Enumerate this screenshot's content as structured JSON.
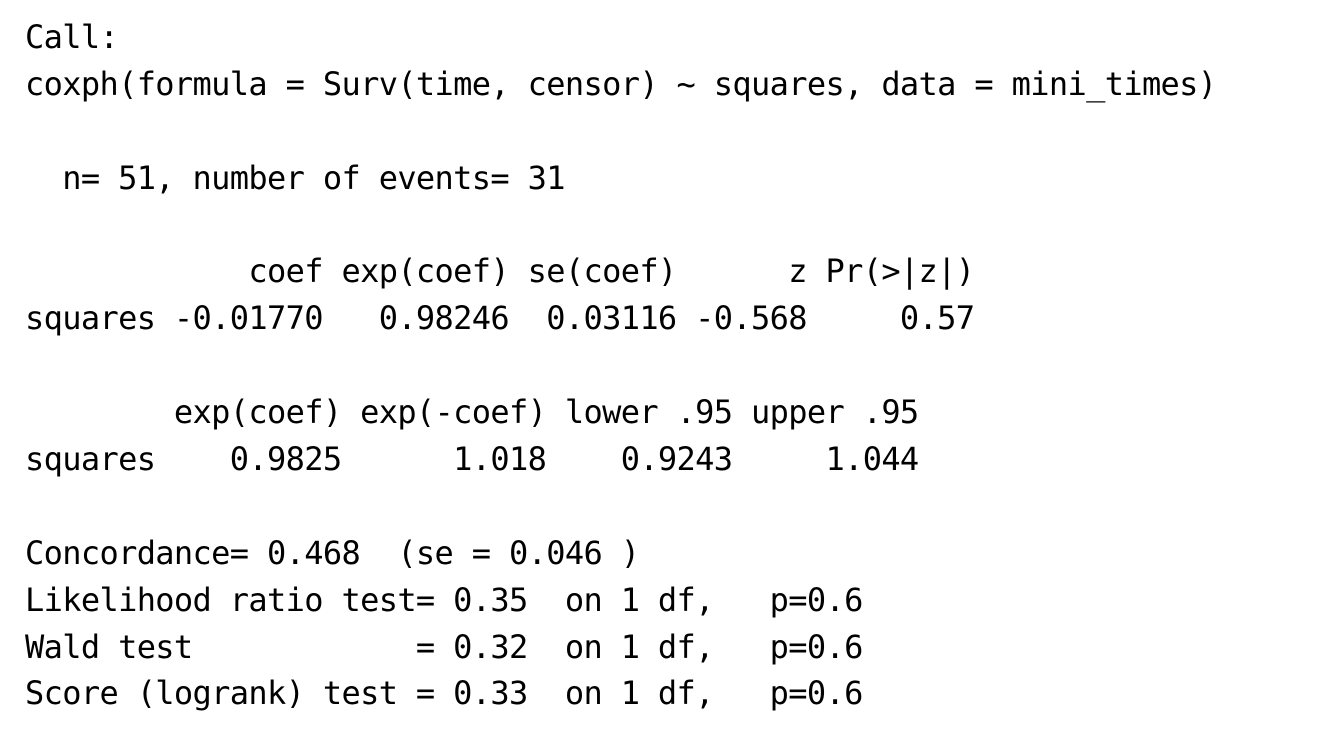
{
  "console": {
    "call_header": "Call:",
    "call_formula": "coxph(formula = Surv(time, censor) ~ squares, data = mini_times)",
    "summary_counts": "  n= 51, number of events= 31",
    "coef_table": {
      "header": "            coef exp(coef) se(coef)      z Pr(>|z|)",
      "rows": [
        "squares -0.01770   0.98246  0.03116 -0.568     0.57"
      ]
    },
    "ci_table": {
      "header": "        exp(coef) exp(-coef) lower .95 upper .95",
      "rows": [
        "squares    0.9825      1.018    0.9243     1.044"
      ]
    },
    "tests": {
      "concordance": "Concordance= 0.468  (se = 0.046 )",
      "likelihood_ratio": "Likelihood ratio test= 0.35  on 1 df,   p=0.6",
      "wald": "Wald test            = 0.32  on 1 df,   p=0.6",
      "score": "Score (logrank) test = 0.33  on 1 df,   p=0.6"
    }
  }
}
